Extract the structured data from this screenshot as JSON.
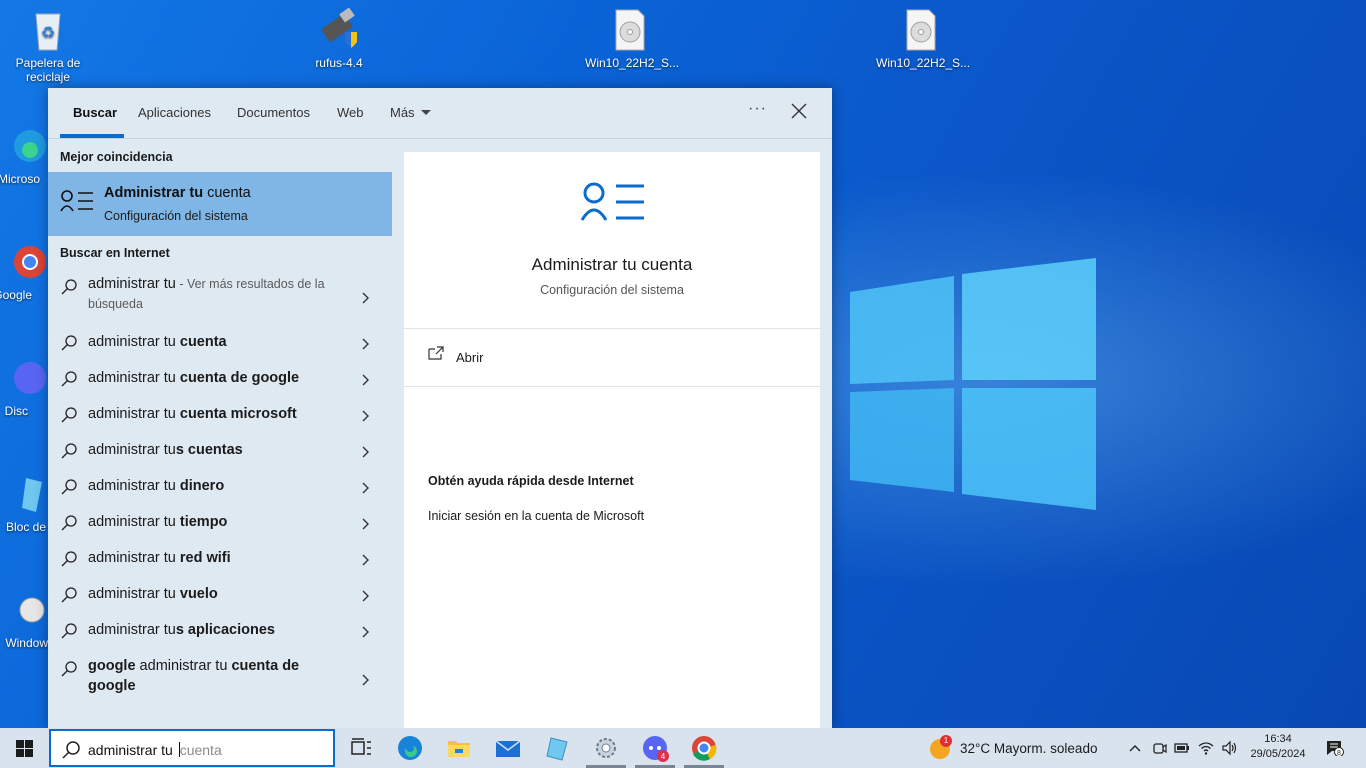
{
  "desktop": {
    "icons": [
      {
        "label": "Papelera de reciclaje"
      },
      {
        "label": "rufus-4.4"
      },
      {
        "label": "Win10_22H2_S..."
      },
      {
        "label": "Win10_22H2_S..."
      },
      {
        "label": "Microso"
      },
      {
        "label": "Google"
      },
      {
        "label": "Disc"
      },
      {
        "label": "Bloc de"
      },
      {
        "label": "Window"
      }
    ]
  },
  "search": {
    "tabs": [
      {
        "label": "Buscar"
      },
      {
        "label": "Aplicaciones"
      },
      {
        "label": "Documentos"
      },
      {
        "label": "Web"
      },
      {
        "label": "Más"
      }
    ],
    "more_options": "···",
    "best_match_header": "Mejor coincidencia",
    "best_match": {
      "title_bold": "Administrar tu",
      "title_rest": " cuenta",
      "subtitle": "Configuración del sistema"
    },
    "web_header": "Buscar en Internet",
    "results": [
      {
        "pre": "administrar tu",
        "bold": "",
        "extra": " - Ver más resultados de la búsqueda"
      },
      {
        "pre": "administrar tu ",
        "bold": "cuenta",
        "extra": ""
      },
      {
        "pre": "administrar tu ",
        "bold": "cuenta de google",
        "extra": ""
      },
      {
        "pre": "administrar tu ",
        "bold": "cuenta microsoft",
        "extra": ""
      },
      {
        "pre": "administrar tu",
        "bold": "s cuentas",
        "extra": ""
      },
      {
        "pre": "administrar tu ",
        "bold": "dinero",
        "extra": ""
      },
      {
        "pre": "administrar tu ",
        "bold": "tiempo",
        "extra": ""
      },
      {
        "pre": "administrar tu ",
        "bold": "red wifi",
        "extra": ""
      },
      {
        "pre": "administrar tu ",
        "bold": "vuelo",
        "extra": ""
      },
      {
        "pre": "administrar tu",
        "bold": "s aplicaciones",
        "extra": ""
      },
      {
        "pre_bold": "google",
        "pre": " administrar tu ",
        "bold": "cuenta de google",
        "extra": ""
      }
    ],
    "preview": {
      "title": "Administrar tu cuenta",
      "subtitle": "Configuración del sistema",
      "open_label": "Abrir",
      "help_header": "Obtén ayuda rápida desde Internet",
      "help_link": "Iniciar sesión en la cuenta de Microsoft"
    }
  },
  "taskbar": {
    "search_typed": "administrar tu ",
    "search_ghost": "cuenta",
    "weather": {
      "badge": "1",
      "text": "32°C  Mayorm. soleado"
    },
    "time": "16:34",
    "date": "29/05/2024",
    "notifications": "8",
    "discord_badge": "4"
  },
  "colors": {
    "accent": "#0a6ccd",
    "best_match_bg": "#7fb6e6",
    "panel_bg": "#dfe9f2",
    "taskbar_bg": "#d9e3ee"
  }
}
